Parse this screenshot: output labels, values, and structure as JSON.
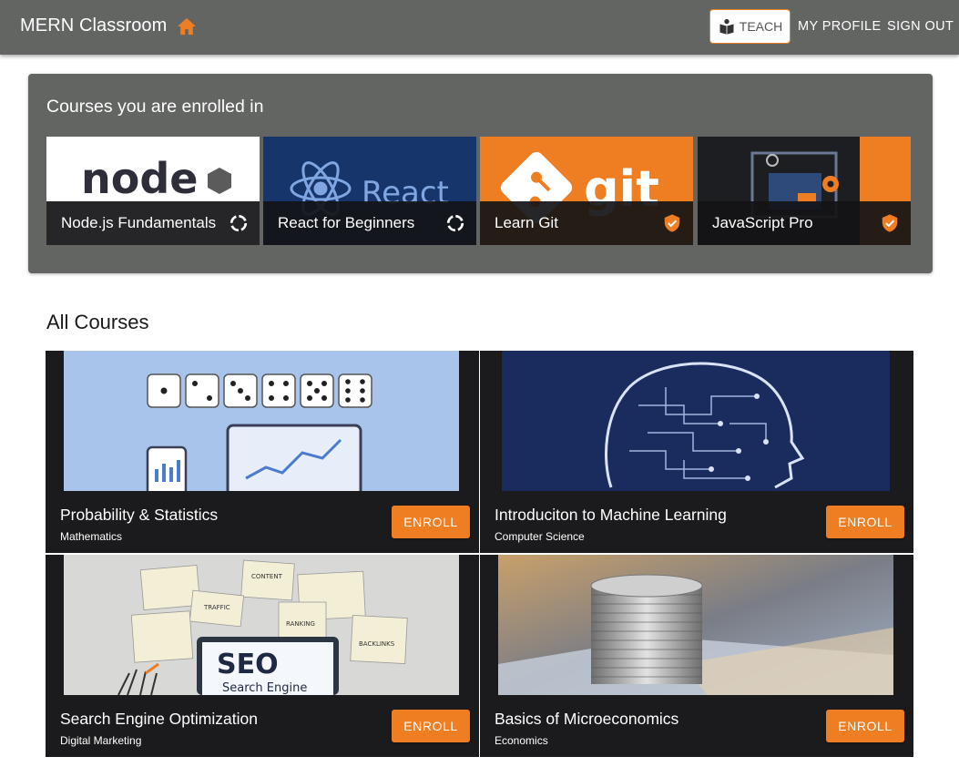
{
  "appbar": {
    "title": "MERN Classroom",
    "teach_label": "TEACH",
    "links": [
      "MY PROFILE",
      "SIGN OUT"
    ],
    "accent": "#ef7d22",
    "home_icon": "home-icon"
  },
  "enrolled": {
    "title": "Courses you are enrolled in",
    "courses": [
      {
        "name": "Node.js Fundamentals",
        "status_icon": "loading-icon",
        "art_text": "node"
      },
      {
        "name": "React for Beginners",
        "status_icon": "loading-icon",
        "art_text": "React"
      },
      {
        "name": "Learn Git",
        "status_icon": "verified-icon",
        "art_text": "git"
      },
      {
        "name": "JavaScript Pro",
        "status_icon": "verified-icon"
      }
    ]
  },
  "all_courses": {
    "title": "All Courses",
    "enroll_label": "ENROLL",
    "courses": [
      {
        "name": "Probability & Statistics",
        "category": "Mathematics"
      },
      {
        "name": "Introduciton to Machine Learning",
        "category": "Computer Science"
      },
      {
        "name": "Search Engine Optimization",
        "category": "Digital Marketing",
        "art_text": [
          "SEO",
          "Search Engine",
          "CONTENT",
          "TRAFFIC",
          "RANKING",
          "BACKLINKS"
        ]
      },
      {
        "name": "Basics of Microeconomics",
        "category": "Economics"
      }
    ]
  }
}
